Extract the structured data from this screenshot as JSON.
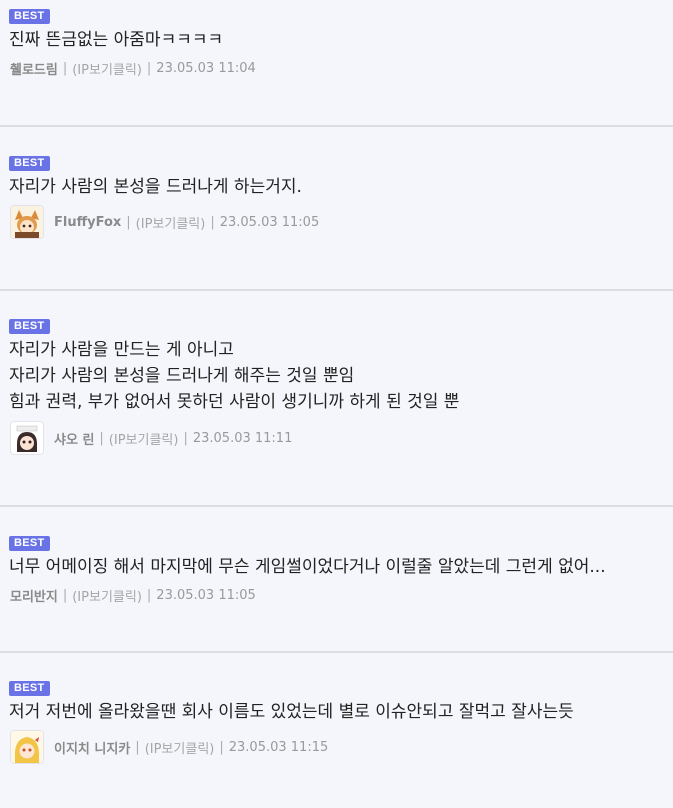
{
  "comments": [
    {
      "badge": "BEST",
      "lines": [
        "진짜 뜬금없는 아줌마ㅋㅋㅋㅋ"
      ],
      "author": "췔로드림",
      "ip": "(IP보기클릭)",
      "datetime": "23.05.03 11:04",
      "has_avatar": false
    },
    {
      "badge": "BEST",
      "lines": [
        "자리가 사람의 본성을 드러나게 하는거지."
      ],
      "author": "FluffyFox",
      "ip": "(IP보기클릭)",
      "datetime": "23.05.03 11:05",
      "has_avatar": true,
      "avatar_icon": "fox-girl-avatar"
    },
    {
      "badge": "BEST",
      "lines": [
        "자리가 사람을 만드는 게 아니고",
        "자리가 사람의 본성을 드러나게 해주는 것일 뿐임",
        "힘과 권력, 부가 없어서 못하던 사람이 생기니까 하게 된 것일 뿐"
      ],
      "author": "샤오 린",
      "ip": "(IP보기클릭)",
      "datetime": "23.05.03 11:11",
      "has_avatar": true,
      "avatar_icon": "dark-hair-girl-avatar"
    },
    {
      "badge": "BEST",
      "lines": [
        "너무 어메이징 해서 마지막에 무슨 게임썰이었다거나 이럴줄 알았는데 그런게 없어..."
      ],
      "author": "모리반지",
      "ip": "(IP보기클릭)",
      "datetime": "23.05.03 11:05",
      "has_avatar": false
    },
    {
      "badge": "BEST",
      "lines": [
        "저거 저번에 올라왔을땐 회사 이름도 있었는데 별로 이슈안되고 잘먹고 잘사는듯"
      ],
      "author": "이지치 니지카",
      "ip": "(IP보기클릭)",
      "datetime": "23.05.03 11:15",
      "has_avatar": true,
      "avatar_icon": "blonde-girl-avatar"
    }
  ],
  "colors": {
    "background": "#f5f6fb",
    "badge": "#6a73e6",
    "divider": "#dcdde3",
    "author": "#8a8a8a"
  }
}
